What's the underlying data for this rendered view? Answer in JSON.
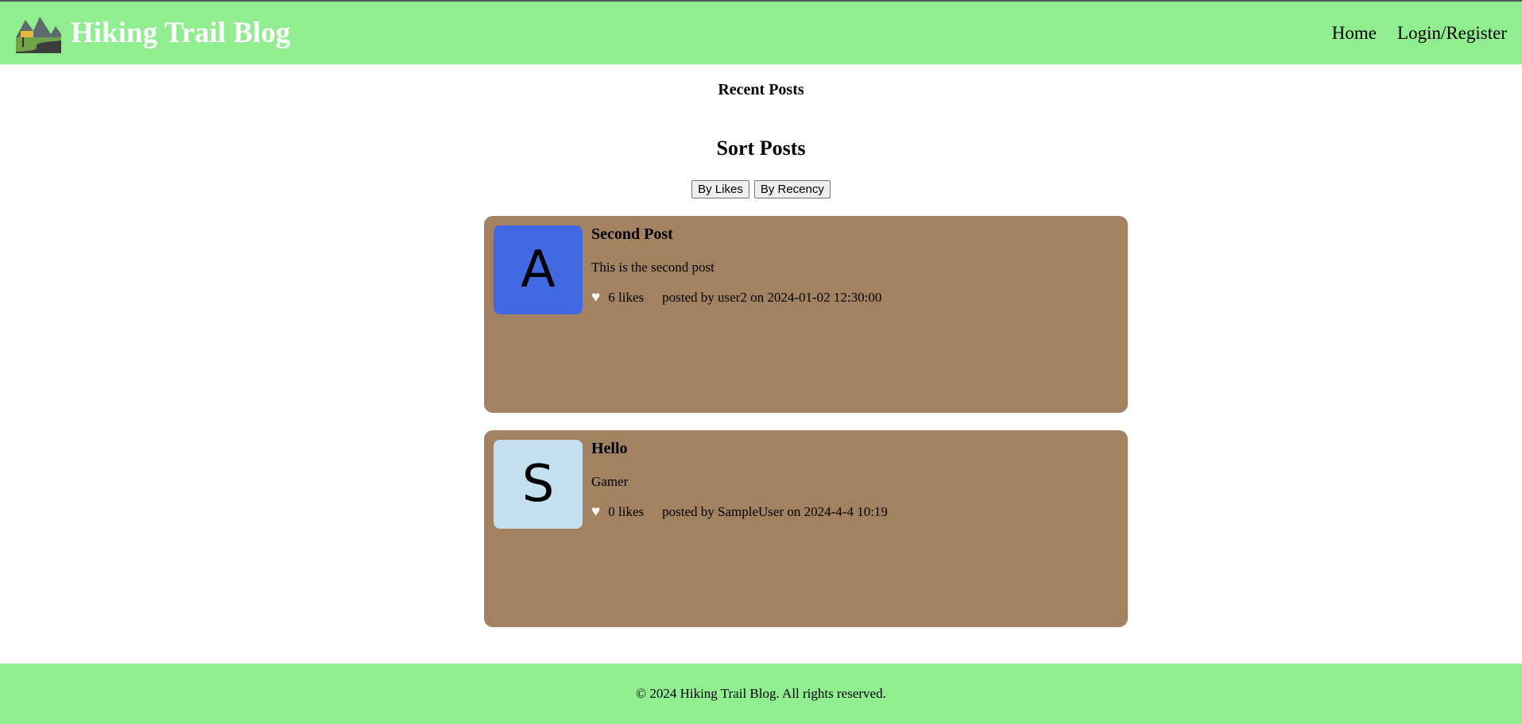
{
  "header": {
    "title": "Hiking Trail Blog",
    "logo_icon": "mountain-trail-logo",
    "nav": [
      {
        "label": "Home"
      },
      {
        "label": "Login/Register"
      }
    ]
  },
  "main": {
    "recent_heading": "Recent Posts",
    "sort_heading": "Sort Posts",
    "sort_buttons": {
      "by_likes": "By Likes",
      "by_recency": "By Recency"
    },
    "posts": [
      {
        "avatar_letter": "A",
        "avatar_color": "#4169e1",
        "title": "Second Post",
        "body": "This is the second post",
        "likes": "6 likes",
        "meta": "posted by user2 on 2024-01-02 12:30:00"
      },
      {
        "avatar_letter": "S",
        "avatar_color": "#c4e0f0",
        "title": "Hello",
        "body": "Gamer",
        "likes": "0 likes",
        "meta": "posted by SampleUser on 2024-4-4 10:19"
      }
    ]
  },
  "footer": {
    "text": "© 2024 Hiking Trail Blog. All rights reserved."
  },
  "colors": {
    "header_bg": "#90ee90",
    "post_bg": "#a38262",
    "title_color": "#ffffff"
  }
}
